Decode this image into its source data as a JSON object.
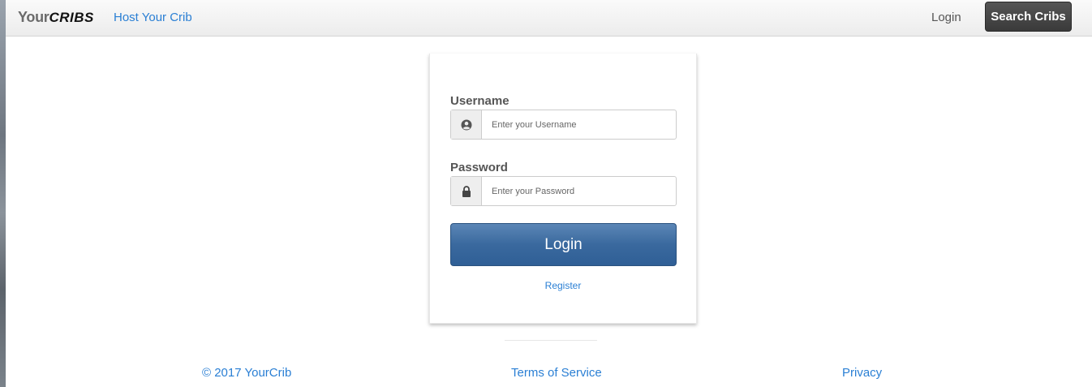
{
  "navbar": {
    "brand_part1": "Your",
    "brand_part2": "CRIBS",
    "host_link": "Host Your Crib",
    "login_link": "Login",
    "search_button": "Search Cribs"
  },
  "login_form": {
    "username_label": "Username",
    "username_placeholder": "Enter your Username",
    "username_icon": "user-icon",
    "password_label": "Password",
    "password_placeholder": "Enter your Password",
    "password_icon": "lock-icon",
    "submit_label": "Login",
    "register_link": "Register"
  },
  "footer": {
    "copyright": "© 2017 YourCrib",
    "terms": "Terms of Service",
    "privacy": "Privacy"
  },
  "colors": {
    "link": "#2a7fd4",
    "primary_button": "#3a699e",
    "dark_button": "#3a3a3a"
  }
}
